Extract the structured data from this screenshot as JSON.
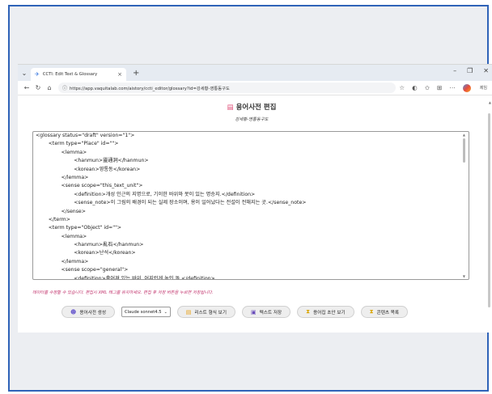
{
  "browser": {
    "tab_title": "CCTI: Edit Text & Glossary",
    "url": "https://app.vaquitalab.com/aistory/ccti_editor/glossary?id=강세황-영통동구도",
    "profile_label": "제임"
  },
  "page": {
    "title": "용어사전 편집",
    "subtitle": "강세황-영통동구도"
  },
  "editor": {
    "lines": [
      "<glossary status=\"draft\" version=\"1\">",
      "        <term type=\"Place\" id=\"\">",
      "                <lemma>",
      "                        <hanmun>靈通洞</hanmun>",
      "                        <korean>영통동</korean>",
      "                </lemma>",
      "                <sense scope=\"this_text_unit\">",
      "                        <definition>개성 인근의 지명으로, 기이한 바위와 못이 있는 명승지.</definition>",
      "                        <sense_note>이 그림의 배경이 되는 실제 장소이며, 용이 일어났다는 전설이 전해지는 곳.</sense_note>",
      "                </sense>",
      "        </term>",
      "        <term type=\"Object\" id=\"\">",
      "                <lemma>",
      "                        <hanmun>亂石</hanmun>",
      "                        <korean>난석</korean>",
      "                </lemma>",
      "                <sense scope=\"general\">",
      "                        <definition>흩어져 있는 바위, 어지럽게 놓인 돌.</definition>"
    ]
  },
  "hint": "데이터를 수정할 수 있습니다. 편집시 XML 태그를 유지하세요. 편집 후 저장 버튼을 누르면 저장됩니다.",
  "buttons": {
    "generate": "용어사전 생성",
    "model_select": "Claude sonnet4.5",
    "list_view": "리스트 형식 보기",
    "save": "텍스트 저장",
    "draft_view": "용어집 초안 보기",
    "content_list": "콘텐츠 목록"
  }
}
